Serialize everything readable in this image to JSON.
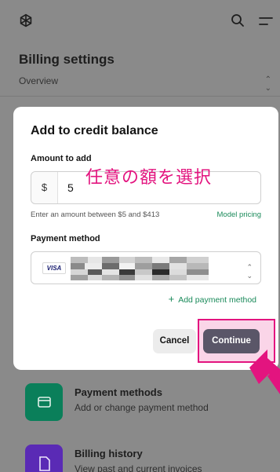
{
  "header": {
    "logo_icon": "openai-logo-icon",
    "search_icon": "search-icon",
    "menu_icon": "menu-icon"
  },
  "page": {
    "title": "Billing settings",
    "section_select": "Overview",
    "cards": [
      {
        "title": "Payment methods",
        "subtitle": "Add or change payment method",
        "icon": "credit-card-icon",
        "color": "#0a7f5a"
      },
      {
        "title": "Billing history",
        "subtitle": "View past and current invoices",
        "icon": "document-icon",
        "color": "#5a2ab5"
      }
    ]
  },
  "modal": {
    "title": "Add to credit balance",
    "amount_label": "Amount to add",
    "currency_symbol": "$",
    "amount_value": "5",
    "hint": "Enter an amount between $5 and $413",
    "pricing_link": "Model pricing",
    "payment_label": "Payment method",
    "card_brand": "VISA",
    "add_payment": "Add payment method",
    "cancel": "Cancel",
    "continue": "Continue"
  },
  "annotation": {
    "text": "任意の額を選択",
    "color": "#e3147f"
  }
}
